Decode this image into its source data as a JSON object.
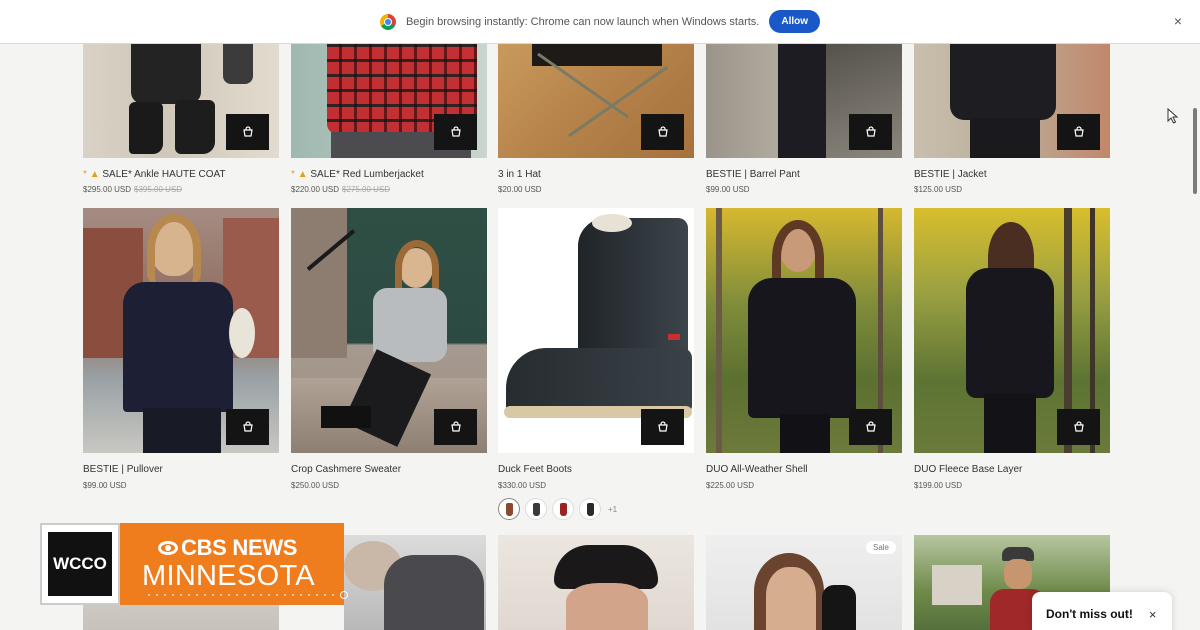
{
  "chrome_notice": {
    "message": "Begin browsing instantly: Chrome can now launch when Windows starts.",
    "allow_label": "Allow",
    "close_glyph": "×",
    "icon": "chrome-logo-icon"
  },
  "products": [
    {
      "title": "SALE* Ankle HAUTE COAT",
      "price": "$295.00 USD",
      "old_price": "$395.00 USD",
      "sale_glyph": "*",
      "icon": "flame-icon"
    },
    {
      "title": "SALE* Red Lumberjacket",
      "price": "$220.00 USD",
      "old_price": "$275.00 USD",
      "sale_glyph": "*",
      "icon": "flame-icon"
    },
    {
      "title": "3 in 1 Hat",
      "price": "$20.00 USD"
    },
    {
      "title": "BESTIE | Barrel Pant",
      "price": "$99.00 USD"
    },
    {
      "title": "BESTIE | Jacket",
      "price": "$125.00 USD"
    },
    {
      "title": "BESTIE | Pullover",
      "price": "$99.00 USD"
    },
    {
      "title": "Crop Cashmere Sweater",
      "price": "$250.00 USD"
    },
    {
      "title": "Duck Feet Boots",
      "price": "$330.00 USD"
    },
    {
      "title": "DUO All-Weather Shell",
      "price": "$225.00 USD"
    },
    {
      "title": "DUO Fleece Base Layer",
      "price": "$199.00 USD"
    }
  ],
  "swatches": {
    "colors": [
      "#8a4a2e",
      "#3a3a3a",
      "#9a2424",
      "#2a2a2a"
    ],
    "more_label": "+1"
  },
  "row3": {
    "badge": "Sale"
  },
  "broadcast": {
    "station": "WCCO",
    "network": "CBS NEWS",
    "region": "MINNESOTA",
    "brand_color": "#f07d1d"
  },
  "popup": {
    "text": "Don't miss out!",
    "close_glyph": "×"
  }
}
